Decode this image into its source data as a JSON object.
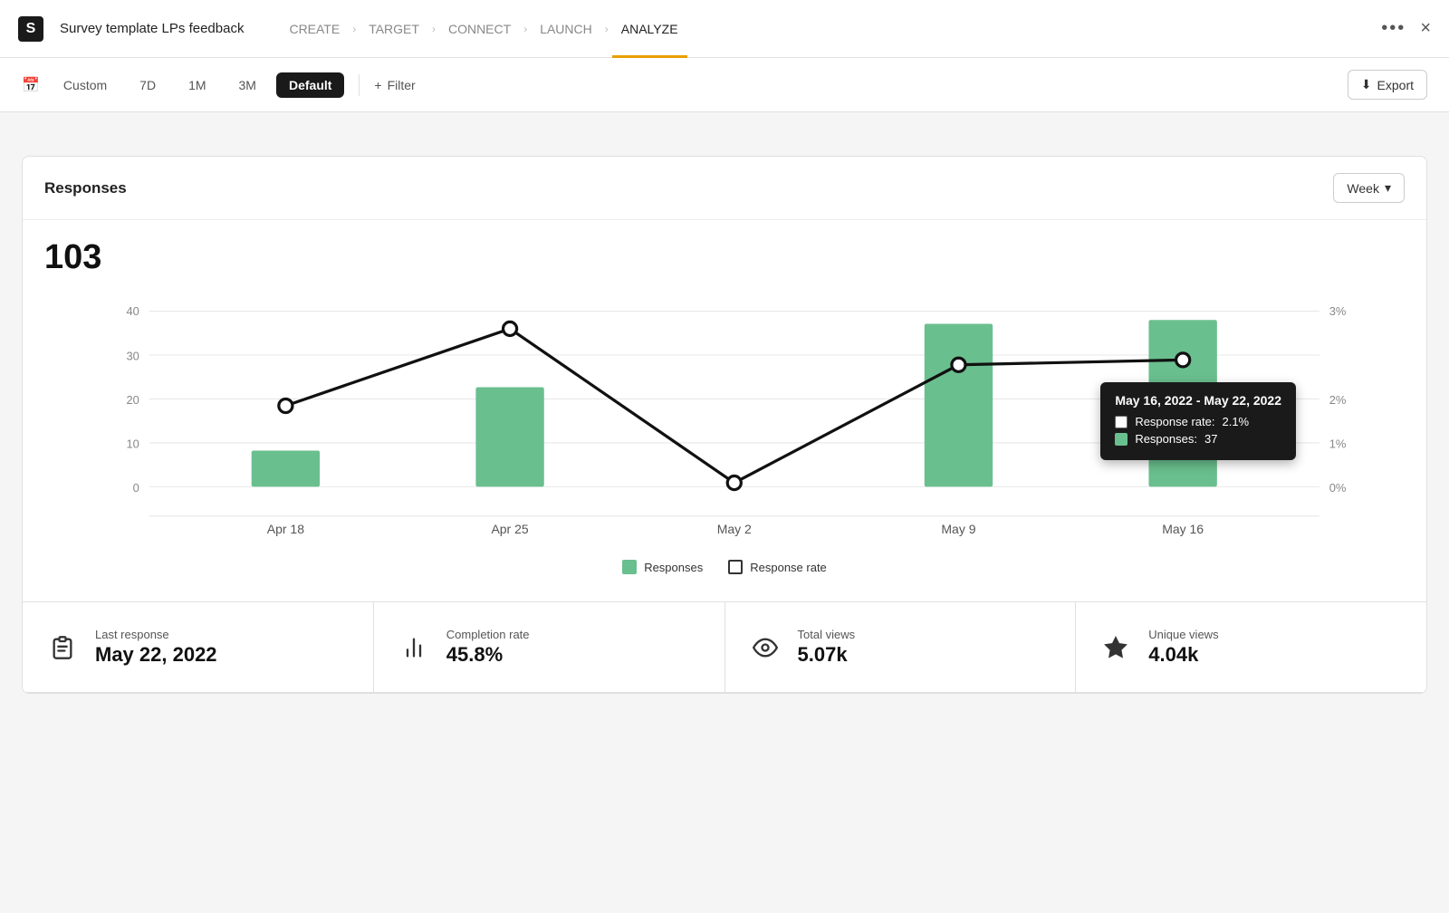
{
  "app": {
    "brand": "S"
  },
  "header": {
    "title": "Survey template LPs feedback",
    "nav_steps": [
      {
        "label": "CREATE",
        "active": false
      },
      {
        "label": "TARGET",
        "active": false
      },
      {
        "label": "CONNECT",
        "active": false
      },
      {
        "label": "LAUNCH",
        "active": false
      },
      {
        "label": "ANALYZE",
        "active": true
      }
    ],
    "more_icon": "•••",
    "close_icon": "×"
  },
  "filterbar": {
    "calendar_label": "Custom",
    "periods": [
      "7D",
      "1M",
      "3M"
    ],
    "default_label": "Default",
    "filter_label": "Filter",
    "export_label": "Export"
  },
  "responses_card": {
    "title": "Responses",
    "week_label": "Week",
    "total": "103",
    "chart": {
      "bars": [
        {
          "label": "Apr 18",
          "value": 8,
          "max": 37
        },
        {
          "label": "Apr 25",
          "value": 22,
          "max": 37
        },
        {
          "label": "May 2",
          "value": 0,
          "max": 37
        },
        {
          "label": "May 9",
          "value": 36,
          "max": 37
        },
        {
          "label": "May 16",
          "value": 37,
          "max": 37
        }
      ],
      "line_points": [
        18,
        35,
        1,
        27,
        28
      ],
      "y_left_max": 40,
      "y_right_max": "3%",
      "tooltip": {
        "title": "May 16, 2022 - May 22, 2022",
        "response_rate_label": "Response rate:",
        "response_rate_value": "2.1%",
        "responses_label": "Responses:",
        "responses_value": "37"
      }
    },
    "legend": {
      "responses_label": "Responses",
      "rate_label": "Response rate"
    }
  },
  "stat_cards": [
    {
      "icon": "📋",
      "label": "Last response",
      "value": "May 22, 2022"
    },
    {
      "icon": "📊",
      "label": "Completion rate",
      "value": "45.8%"
    },
    {
      "icon": "👁",
      "label": "Total views",
      "value": "5.07k"
    },
    {
      "icon": "★",
      "label": "Unique views",
      "value": "4.04k"
    }
  ]
}
